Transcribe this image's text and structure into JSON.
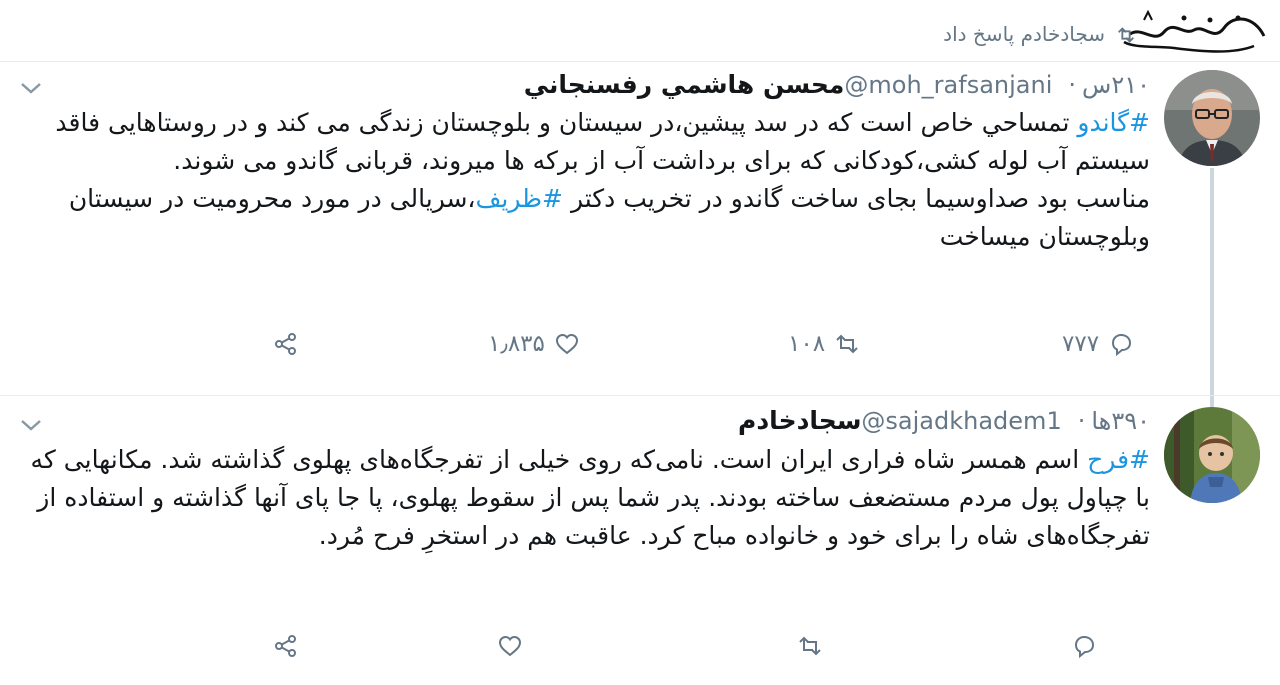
{
  "context": {
    "text": "سجادخادم پاسخ داد"
  },
  "watermark": {
    "text": "شهدای ایران"
  },
  "tweets": [
    {
      "name": "محسن هاشمي رفسنجاني",
      "handle": "@moh_rafsanjani",
      "dot": "·",
      "time": "۲۱۰س",
      "body_lines": [
        {
          "hashtag": "#گاندو",
          "text": " تمساحي خاص است که در سد پيشين،در سيستان و بلوچستان زندگی می کند و در روستاهایی فاقد سیستم آب لوله کشی،کودکانی که برای برداشت آب از برکه ها میروند، قربانی گاندو می شوند."
        },
        {
          "pre": "مناسب بود صداوسیما بجای ساخت گاندو در تخریب دکتر ",
          "hashtag": "#ظریف",
          "text": "،سریالی در مورد محرومیت در سیستان وبلوچستان میساخت"
        }
      ],
      "actions": {
        "reply": "۷۷۷",
        "retweet": "۱۰۸",
        "like": "۱٫۸۳۵",
        "share": ""
      }
    },
    {
      "name": "سجادخادم",
      "handle": "@sajadkhadem1",
      "dot": "·",
      "time": "۳۹۰ها",
      "body_lines": [
        {
          "hashtag": "#فرح",
          "text": " اسم همسر شاه فراری ایران است. نامی‌که روی خیلی از تفرجگاه‌های پهلوی گذاشته شد. مکانهایی که با چپاول پول مردم مستضعف ساخته بودند. پدر شما پس از سقوط پهلوی، پا جا پای آنها گذاشته و استفاده از تفرجگاه‌های شاه را برای خود و خانواده مباح کرد. عاقبت هم در استخرِ فرح مُرد."
        }
      ],
      "actions": {
        "reply": "",
        "retweet": "",
        "like": "",
        "share": ""
      }
    }
  ],
  "colors": {
    "hashtag": "#1b95e0",
    "muted": "#657786",
    "divider": "#e6ecf0",
    "thread": "#ccd6dd"
  },
  "icons": [
    "retweet-icon",
    "reply-icon",
    "like-icon",
    "share-icon",
    "chevron-down-icon"
  ]
}
